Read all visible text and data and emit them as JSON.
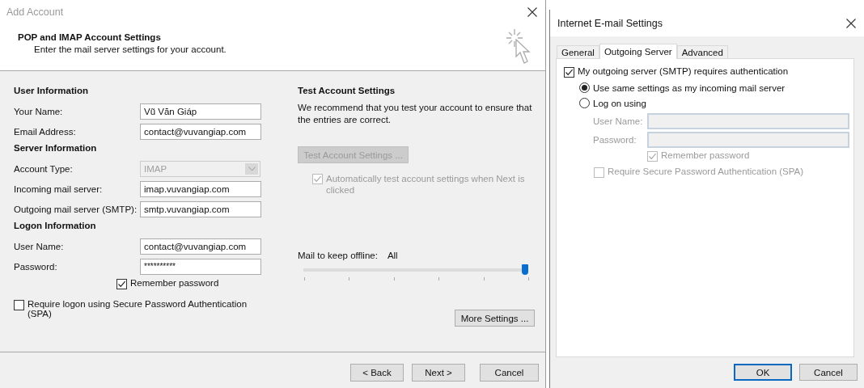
{
  "add_account": {
    "title": "Add Account",
    "header": {
      "title": "POP and IMAP Account Settings",
      "subtitle": "Enter the mail server settings for your account."
    },
    "sections": [
      {
        "heading": "User Information",
        "fields": [
          {
            "label": "Your Name:",
            "value": "Vũ Văn Giáp",
            "kind": "text",
            "disabled": false
          },
          {
            "label": "Email Address:",
            "value": "contact@vuvangiap.com",
            "kind": "text",
            "disabled": false
          }
        ]
      },
      {
        "heading": "Server Information",
        "fields": [
          {
            "label": "Account Type:",
            "value": "IMAP",
            "kind": "select",
            "disabled": true
          },
          {
            "label": "Incoming mail server:",
            "value": "imap.vuvangiap.com",
            "kind": "text",
            "disabled": false
          },
          {
            "label": "Outgoing mail server (SMTP):",
            "value": "smtp.vuvangiap.com",
            "kind": "text",
            "disabled": false
          }
        ]
      },
      {
        "heading": "Logon Information",
        "fields": [
          {
            "label": "User Name:",
            "value": "contact@vuvangiap.com",
            "kind": "text",
            "disabled": false
          },
          {
            "label": "Password:",
            "value": "**********",
            "kind": "password",
            "disabled": false
          }
        ]
      }
    ],
    "remember_password": {
      "label": "Remember password",
      "checked": true
    },
    "spa": {
      "label": "Require logon using Secure Password Authentication (SPA)",
      "checked": false
    },
    "test": {
      "heading": "Test Account Settings",
      "description": "We recommend that you test your account to ensure that the entries are correct.",
      "button": {
        "label": "Test Account Settings ...",
        "disabled": true
      },
      "auto_test": {
        "label": "Automatically test account settings when Next is clicked",
        "checked": true,
        "disabled": true
      }
    },
    "offline": {
      "label": "Mail to keep offline:",
      "value": "All",
      "level": 1
    },
    "more_settings": "More Settings ...",
    "buttons": [
      "< Back",
      "Next >",
      "Cancel"
    ]
  },
  "internet_email_settings": {
    "title": "Internet E-mail Settings",
    "tabs": [
      {
        "label": "General",
        "selected": false
      },
      {
        "label": "Outgoing Server",
        "selected": true
      },
      {
        "label": "Advanced",
        "selected": false
      }
    ],
    "smtp_auth": {
      "label": "My outgoing server (SMTP) requires authentication",
      "checked": true
    },
    "auth_options": [
      {
        "label": "Use same settings as my incoming mail server",
        "selected": true
      },
      {
        "label": "Log on using",
        "selected": false
      }
    ],
    "logon_fields": [
      {
        "label": "User Name:",
        "disabled": true
      },
      {
        "label": "Password:",
        "disabled": true
      }
    ],
    "remember_password": {
      "label": "Remember password",
      "checked": true,
      "disabled": true
    },
    "spa": {
      "label": "Require Secure Password Authentication (SPA)",
      "checked": false,
      "disabled": true
    },
    "buttons": [
      {
        "label": "OK",
        "default": true
      },
      {
        "label": "Cancel",
        "default": false
      }
    ]
  }
}
